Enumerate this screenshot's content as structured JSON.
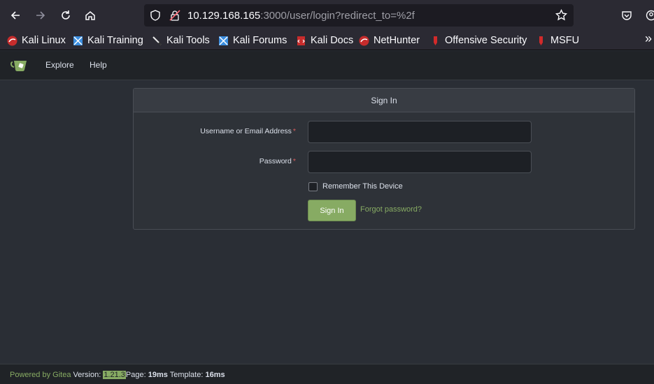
{
  "browser": {
    "url_host": "10.129.168.165",
    "url_rest": ":3000/user/login?redirect_to=%2f",
    "bookmarks": [
      "Kali Linux",
      "Kali Training",
      "Kali Tools",
      "Kali Forums",
      "Kali Docs",
      "NetHunter",
      "Offensive Security",
      "MSFU"
    ],
    "more": "»"
  },
  "header": {
    "nav": [
      "Explore",
      "Help"
    ]
  },
  "signin": {
    "title": "Sign In",
    "username_label": "Username or Email Address",
    "password_label": "Password",
    "required_mark": "*",
    "username_value": "",
    "password_value": "",
    "remember_label": "Remember This Device",
    "remember_checked": false,
    "submit_label": "Sign In",
    "forgot_label": "Forgot password?"
  },
  "footer": {
    "powered_by": "Powered by Gitea",
    "version_label": "Version:",
    "version": "1.21.3",
    "page_label": "Page:",
    "page_time": "19ms",
    "template_label": "Template:",
    "template_time": "16ms"
  },
  "colors": {
    "accent": "#87ab63",
    "background": "#2a2e35",
    "header": "#202327",
    "required": "#d95c5c"
  }
}
